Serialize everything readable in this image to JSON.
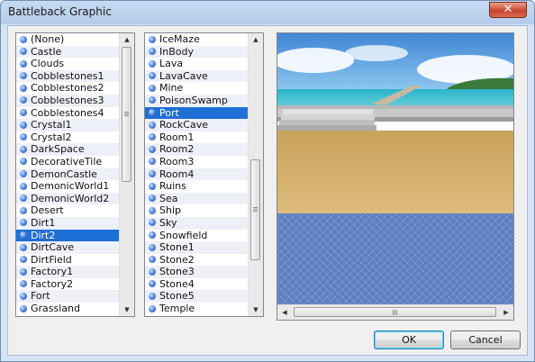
{
  "window": {
    "title": "Battleback Graphic",
    "close_glyph": "✕"
  },
  "list1": {
    "selected": "Dirt2",
    "items": [
      "(None)",
      "Castle",
      "Clouds",
      "Cobblestones1",
      "Cobblestones2",
      "Cobblestones3",
      "Cobblestones4",
      "Crystal1",
      "Crystal2",
      "DarkSpace",
      "DecorativeTile",
      "DemonCastle",
      "DemonicWorld1",
      "DemonicWorld2",
      "Desert",
      "Dirt1",
      "Dirt2",
      "DirtCave",
      "DirtField",
      "Factory1",
      "Factory2",
      "Fort",
      "Grassland"
    ]
  },
  "list2": {
    "selected": "Port",
    "items": [
      "IceMaze",
      "InBody",
      "Lava",
      "LavaCave",
      "Mine",
      "PoisonSwamp",
      "Port",
      "RockCave",
      "Room1",
      "Room2",
      "Room3",
      "Room4",
      "Ruins",
      "Sea",
      "Ship",
      "Sky",
      "Snowfield",
      "Stone1",
      "Stone2",
      "Stone3",
      "Stone4",
      "Stone5",
      "Temple"
    ]
  },
  "scroll": {
    "up_glyph": "▲",
    "down_glyph": "▼",
    "left_glyph": "◀",
    "right_glyph": "▶"
  },
  "buttons": {
    "ok": "OK",
    "cancel": "Cancel"
  },
  "icons": {
    "list_item": "blue-orb-icon"
  }
}
